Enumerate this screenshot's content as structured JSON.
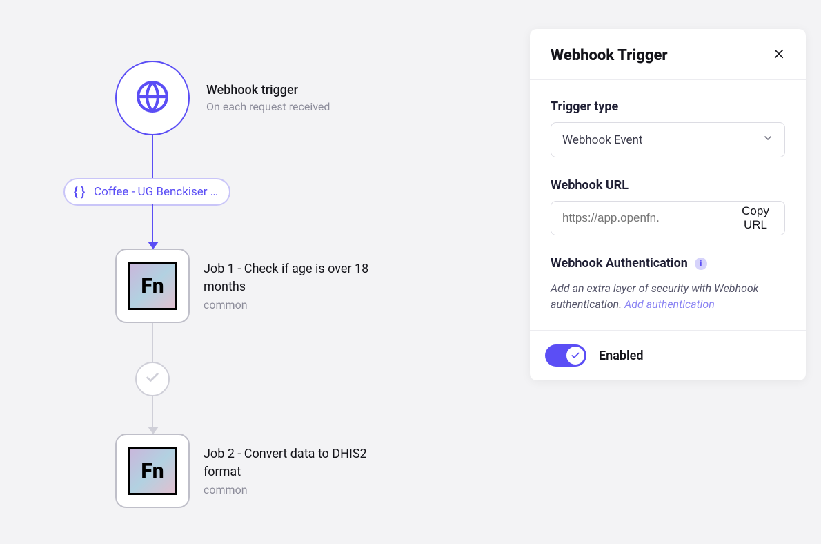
{
  "graph": {
    "trigger": {
      "title": "Webhook trigger",
      "subtitle": "On each request received"
    },
    "edge_label": "Coffee - UG Benckiser …",
    "job1": {
      "title": "Job 1 - Check if age is over 18 months",
      "adaptor": "common",
      "badge": "Fn"
    },
    "job2": {
      "title": "Job 2 - Convert data to DHIS2 format",
      "adaptor": "common",
      "badge": "Fn"
    }
  },
  "panel": {
    "heading": "Webhook Trigger",
    "sections": {
      "trigger_type": {
        "label": "Trigger type",
        "value": "Webhook Event"
      },
      "url": {
        "label": "Webhook URL",
        "placeholder": "https://app.openfn.",
        "copy_label": "Copy URL"
      },
      "auth": {
        "label": "Webhook Authentication",
        "desc_prefix": "Add an extra layer of security with Webhook authentication. ",
        "link": "Add authentication"
      }
    },
    "footer": {
      "enabled_label": "Enabled"
    }
  }
}
